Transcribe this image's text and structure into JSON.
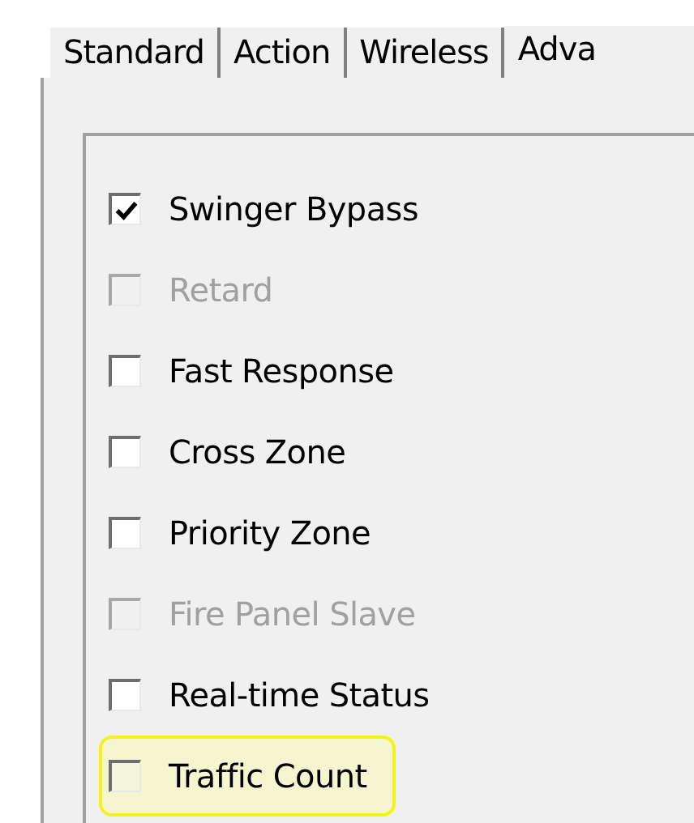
{
  "tabs": [
    {
      "label": "Standard",
      "selected": false
    },
    {
      "label": "Action",
      "selected": false
    },
    {
      "label": "Wireless",
      "selected": false
    },
    {
      "label": "Adva",
      "selected": true
    }
  ],
  "options": [
    {
      "label": "Swinger Bypass",
      "checked": true,
      "disabled": false,
      "highlighted": false
    },
    {
      "label": "Retard",
      "checked": false,
      "disabled": true,
      "highlighted": false
    },
    {
      "label": "Fast Response",
      "checked": false,
      "disabled": false,
      "highlighted": false
    },
    {
      "label": "Cross Zone",
      "checked": false,
      "disabled": false,
      "highlighted": false
    },
    {
      "label": "Priority Zone",
      "checked": false,
      "disabled": false,
      "highlighted": false
    },
    {
      "label": "Fire Panel Slave",
      "checked": false,
      "disabled": true,
      "highlighted": false
    },
    {
      "label": "Real-time Status",
      "checked": false,
      "disabled": false,
      "highlighted": false
    },
    {
      "label": "Traffic Count",
      "checked": false,
      "disabled": false,
      "highlighted": true
    }
  ]
}
